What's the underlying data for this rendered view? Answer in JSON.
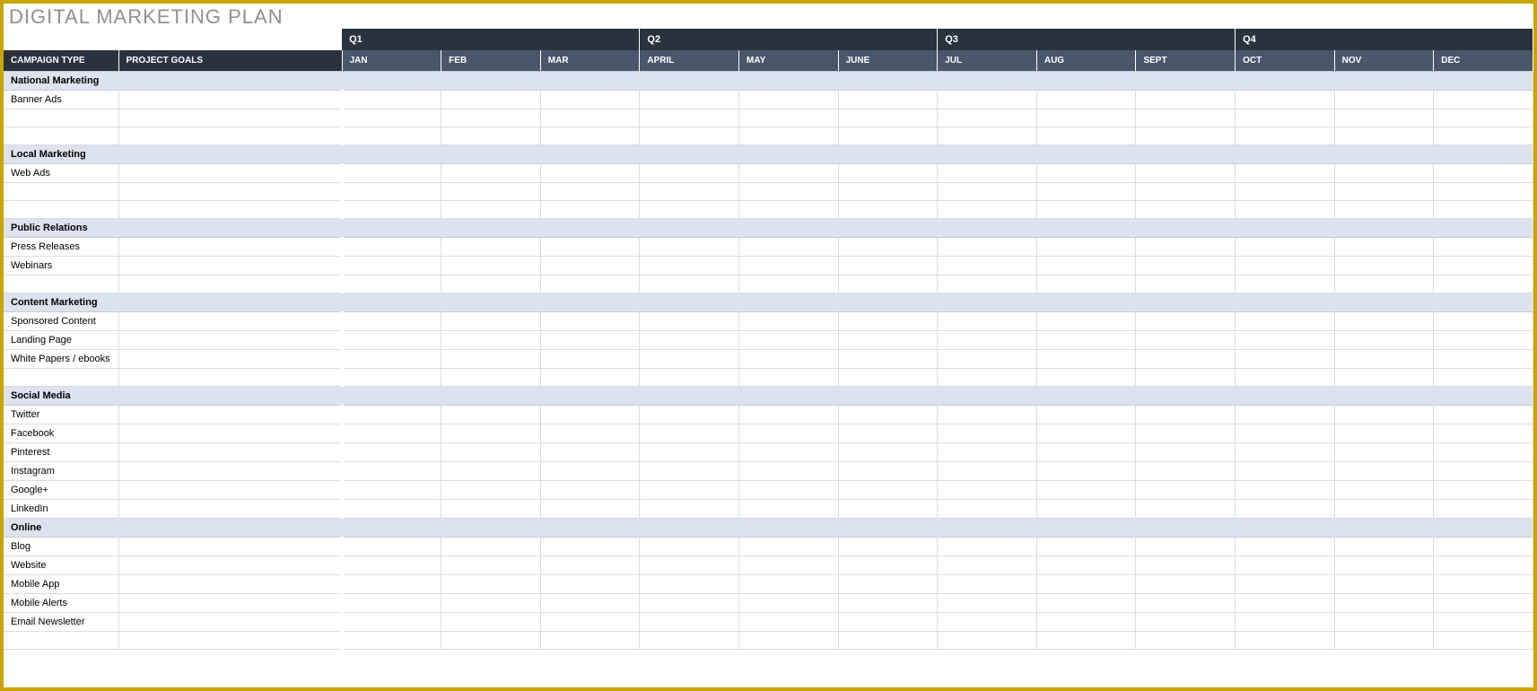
{
  "title": "DIGITAL MARKETING PLAN",
  "headers": {
    "campaign_type": "CAMPAIGN TYPE",
    "project_goals": "PROJECT GOALS"
  },
  "quarters": [
    "Q1",
    "Q2",
    "Q3",
    "Q4"
  ],
  "months": [
    "JAN",
    "FEB",
    "MAR",
    "APRIL",
    "MAY",
    "JUNE",
    "JUL",
    "AUG",
    "SEPT",
    "OCT",
    "NOV",
    "DEC"
  ],
  "sections": [
    {
      "name": "National Marketing",
      "rows": [
        {
          "campaign": "Banner Ads",
          "goals": "",
          "months": [
            "",
            "",
            "",
            "",
            "",
            "",
            "",
            "",
            "",
            "",
            "",
            ""
          ]
        },
        {
          "campaign": "",
          "goals": "",
          "months": [
            "",
            "",
            "",
            "",
            "",
            "",
            "",
            "",
            "",
            "",
            "",
            ""
          ]
        },
        {
          "campaign": "",
          "goals": "",
          "months": [
            "",
            "",
            "",
            "",
            "",
            "",
            "",
            "",
            "",
            "",
            "",
            ""
          ]
        }
      ]
    },
    {
      "name": "Local Marketing",
      "rows": [
        {
          "campaign": "Web Ads",
          "goals": "",
          "months": [
            "",
            "",
            "",
            "",
            "",
            "",
            "",
            "",
            "",
            "",
            "",
            ""
          ]
        },
        {
          "campaign": "",
          "goals": "",
          "months": [
            "",
            "",
            "",
            "",
            "",
            "",
            "",
            "",
            "",
            "",
            "",
            ""
          ]
        },
        {
          "campaign": "",
          "goals": "",
          "months": [
            "",
            "",
            "",
            "",
            "",
            "",
            "",
            "",
            "",
            "",
            "",
            ""
          ]
        }
      ]
    },
    {
      "name": "Public Relations",
      "rows": [
        {
          "campaign": "Press Releases",
          "goals": "",
          "months": [
            "",
            "",
            "",
            "",
            "",
            "",
            "",
            "",
            "",
            "",
            "",
            ""
          ]
        },
        {
          "campaign": "Webinars",
          "goals": "",
          "months": [
            "",
            "",
            "",
            "",
            "",
            "",
            "",
            "",
            "",
            "",
            "",
            ""
          ]
        },
        {
          "campaign": "",
          "goals": "",
          "months": [
            "",
            "",
            "",
            "",
            "",
            "",
            "",
            "",
            "",
            "",
            "",
            ""
          ]
        }
      ]
    },
    {
      "name": "Content Marketing",
      "rows": [
        {
          "campaign": "Sponsored Content",
          "goals": "",
          "months": [
            "",
            "",
            "",
            "",
            "",
            "",
            "",
            "",
            "",
            "",
            "",
            ""
          ]
        },
        {
          "campaign": "Landing Page",
          "goals": "",
          "months": [
            "",
            "",
            "",
            "",
            "",
            "",
            "",
            "",
            "",
            "",
            "",
            ""
          ]
        },
        {
          "campaign": "White Papers / ebooks",
          "goals": "",
          "months": [
            "",
            "",
            "",
            "",
            "",
            "",
            "",
            "",
            "",
            "",
            "",
            ""
          ]
        },
        {
          "campaign": "",
          "goals": "",
          "months": [
            "",
            "",
            "",
            "",
            "",
            "",
            "",
            "",
            "",
            "",
            "",
            ""
          ]
        }
      ]
    },
    {
      "name": "Social Media",
      "rows": [
        {
          "campaign": "Twitter",
          "goals": "",
          "months": [
            "",
            "",
            "",
            "",
            "",
            "",
            "",
            "",
            "",
            "",
            "",
            ""
          ]
        },
        {
          "campaign": "Facebook",
          "goals": "",
          "months": [
            "",
            "",
            "",
            "",
            "",
            "",
            "",
            "",
            "",
            "",
            "",
            ""
          ]
        },
        {
          "campaign": "Pinterest",
          "goals": "",
          "months": [
            "",
            "",
            "",
            "",
            "",
            "",
            "",
            "",
            "",
            "",
            "",
            ""
          ]
        },
        {
          "campaign": "Instagram",
          "goals": "",
          "months": [
            "",
            "",
            "",
            "",
            "",
            "",
            "",
            "",
            "",
            "",
            "",
            ""
          ]
        },
        {
          "campaign": "Google+",
          "goals": "",
          "months": [
            "",
            "",
            "",
            "",
            "",
            "",
            "",
            "",
            "",
            "",
            "",
            ""
          ]
        },
        {
          "campaign": "LinkedIn",
          "goals": "",
          "months": [
            "",
            "",
            "",
            "",
            "",
            "",
            "",
            "",
            "",
            "",
            "",
            ""
          ]
        }
      ]
    },
    {
      "name": "Online",
      "rows": [
        {
          "campaign": "Blog",
          "goals": "",
          "months": [
            "",
            "",
            "",
            "",
            "",
            "",
            "",
            "",
            "",
            "",
            "",
            ""
          ]
        },
        {
          "campaign": "Website",
          "goals": "",
          "months": [
            "",
            "",
            "",
            "",
            "",
            "",
            "",
            "",
            "",
            "",
            "",
            ""
          ]
        },
        {
          "campaign": "Mobile App",
          "goals": "",
          "months": [
            "",
            "",
            "",
            "",
            "",
            "",
            "",
            "",
            "",
            "",
            "",
            ""
          ]
        },
        {
          "campaign": "Mobile Alerts",
          "goals": "",
          "months": [
            "",
            "",
            "",
            "",
            "",
            "",
            "",
            "",
            "",
            "",
            "",
            ""
          ]
        },
        {
          "campaign": "Email Newsletter",
          "goals": "",
          "months": [
            "",
            "",
            "",
            "",
            "",
            "",
            "",
            "",
            "",
            "",
            "",
            ""
          ]
        },
        {
          "campaign": "",
          "goals": "",
          "months": [
            "",
            "",
            "",
            "",
            "",
            "",
            "",
            "",
            "",
            "",
            "",
            ""
          ]
        }
      ]
    }
  ]
}
